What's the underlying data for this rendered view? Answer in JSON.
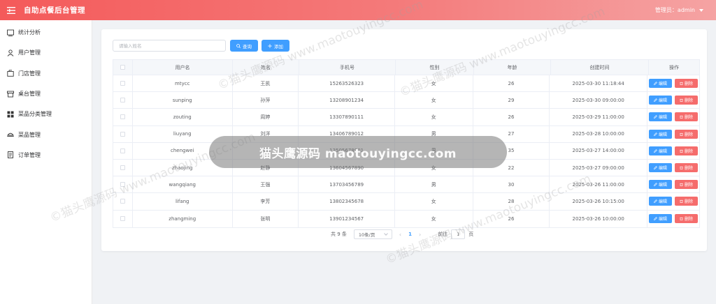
{
  "header": {
    "title": "自助点餐后台管理",
    "user_label": "管理员：admin"
  },
  "sidebar": {
    "items": [
      {
        "label": "统计分析",
        "icon": "chart-icon"
      },
      {
        "label": "用户管理",
        "icon": "user-icon"
      },
      {
        "label": "门店管理",
        "icon": "store-icon"
      },
      {
        "label": "桌台管理",
        "icon": "table-icon"
      },
      {
        "label": "菜品分类管理",
        "icon": "grid-icon"
      },
      {
        "label": "菜品管理",
        "icon": "dish-icon"
      },
      {
        "label": "订单管理",
        "icon": "order-icon"
      }
    ]
  },
  "toolbar": {
    "search_placeholder": "请输入姓名",
    "query_label": "查询",
    "add_label": "添加"
  },
  "table": {
    "columns": [
      "用户名",
      "姓名",
      "手机号",
      "性别",
      "年龄",
      "创建时间",
      "操作"
    ],
    "edit_label": "编辑",
    "delete_label": "删除",
    "rows": [
      {
        "username": "mtycc",
        "name": "王凯",
        "phone": "15263526323",
        "gender": "女",
        "age": "26",
        "created": "2025-03-30 11:18:44"
      },
      {
        "username": "sunping",
        "name": "孙萍",
        "phone": "13208901234",
        "gender": "女",
        "age": "29",
        "created": "2025-03-30 09:00:00"
      },
      {
        "username": "zouting",
        "name": "周婷",
        "phone": "13307890111",
        "gender": "女",
        "age": "26",
        "created": "2025-03-29 11:00:00"
      },
      {
        "username": "liuyang",
        "name": "刘洋",
        "phone": "13406789012",
        "gender": "男",
        "age": "27",
        "created": "2025-03-28 10:00:00"
      },
      {
        "username": "chengwei",
        "name": "陈伟",
        "phone": "13505678901",
        "gender": "男",
        "age": "35",
        "created": "2025-03-27 14:00:00"
      },
      {
        "username": "zhaojing",
        "name": "赵静",
        "phone": "13604567890",
        "gender": "女",
        "age": "22",
        "created": "2025-03-27 09:00:00"
      },
      {
        "username": "wangqiang",
        "name": "王强",
        "phone": "13703456789",
        "gender": "男",
        "age": "30",
        "created": "2025-03-26 11:00:00"
      },
      {
        "username": "lifang",
        "name": "李芳",
        "phone": "13802345678",
        "gender": "女",
        "age": "28",
        "created": "2025-03-26 10:15:00"
      },
      {
        "username": "zhangming",
        "name": "张明",
        "phone": "13901234567",
        "gender": "女",
        "age": "26",
        "created": "2025-03-26 10:00:00"
      }
    ]
  },
  "pagination": {
    "total": "共 9 条",
    "page_size": "10条/页",
    "current_page": "1",
    "goto_label": "前往",
    "goto_value": "1",
    "page_suffix": "页"
  },
  "watermark": {
    "pill_text": "猫头鹰源码 maotouyingcc.com",
    "tile_text": "©猫头鹰源码 www.maotouyingcc.com"
  },
  "colors": {
    "header_start": "#f45a5a",
    "primary": "#409eff",
    "danger": "#f56c6c"
  }
}
